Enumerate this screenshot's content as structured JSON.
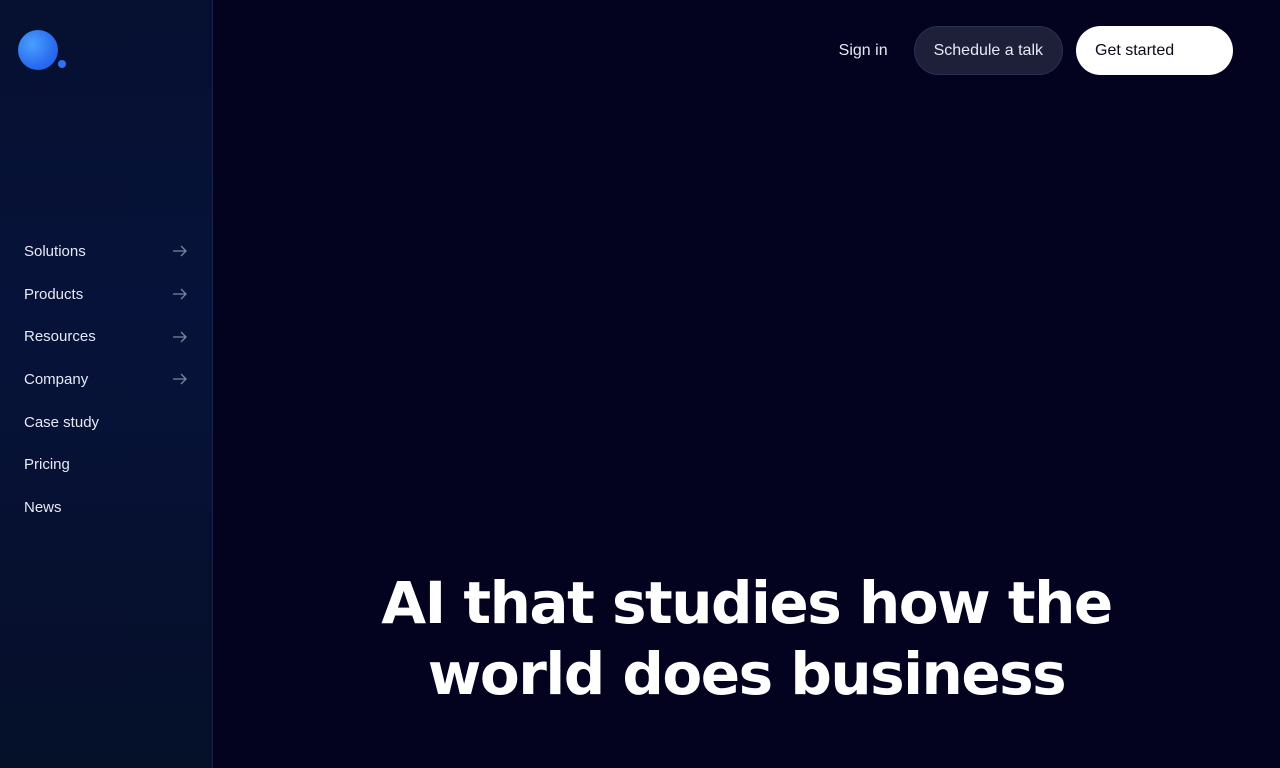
{
  "nav": {
    "items": [
      {
        "label": "Solutions",
        "has_arrow": true
      },
      {
        "label": "Products",
        "has_arrow": true
      },
      {
        "label": "Resources",
        "has_arrow": true
      },
      {
        "label": "Company",
        "has_arrow": true
      },
      {
        "label": "Case study",
        "has_arrow": false
      },
      {
        "label": "Pricing",
        "has_arrow": false
      },
      {
        "label": "News",
        "has_arrow": false
      }
    ]
  },
  "header": {
    "sign_in": "Sign in",
    "schedule": "Schedule a talk",
    "get_started": "Get started"
  },
  "hero": {
    "line1": "AI that studies how the",
    "line2": "world does business"
  },
  "colors": {
    "background": "#03031f",
    "accent": "#2f72f3"
  },
  "icons": {
    "logo": "logo-dot-icon",
    "arrow": "arrow-right-icon"
  }
}
